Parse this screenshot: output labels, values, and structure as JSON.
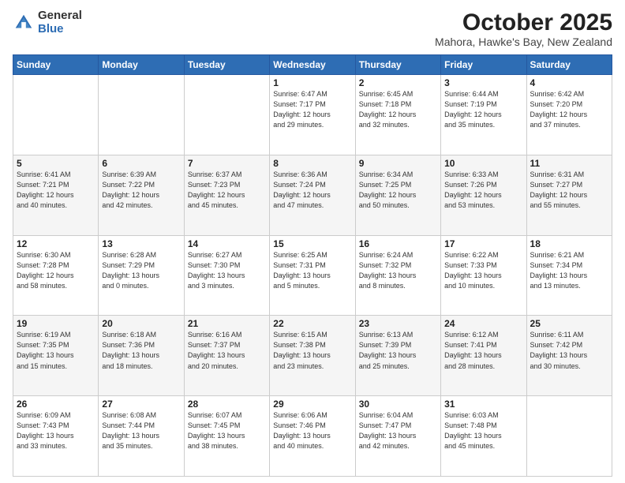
{
  "header": {
    "logo": {
      "general": "General",
      "blue": "Blue"
    },
    "title": "October 2025",
    "subtitle": "Mahora, Hawke's Bay, New Zealand"
  },
  "days_of_week": [
    "Sunday",
    "Monday",
    "Tuesday",
    "Wednesday",
    "Thursday",
    "Friday",
    "Saturday"
  ],
  "weeks": [
    [
      {
        "day": "",
        "info": ""
      },
      {
        "day": "",
        "info": ""
      },
      {
        "day": "",
        "info": ""
      },
      {
        "day": "1",
        "info": "Sunrise: 6:47 AM\nSunset: 7:17 PM\nDaylight: 12 hours\nand 29 minutes."
      },
      {
        "day": "2",
        "info": "Sunrise: 6:45 AM\nSunset: 7:18 PM\nDaylight: 12 hours\nand 32 minutes."
      },
      {
        "day": "3",
        "info": "Sunrise: 6:44 AM\nSunset: 7:19 PM\nDaylight: 12 hours\nand 35 minutes."
      },
      {
        "day": "4",
        "info": "Sunrise: 6:42 AM\nSunset: 7:20 PM\nDaylight: 12 hours\nand 37 minutes."
      }
    ],
    [
      {
        "day": "5",
        "info": "Sunrise: 6:41 AM\nSunset: 7:21 PM\nDaylight: 12 hours\nand 40 minutes."
      },
      {
        "day": "6",
        "info": "Sunrise: 6:39 AM\nSunset: 7:22 PM\nDaylight: 12 hours\nand 42 minutes."
      },
      {
        "day": "7",
        "info": "Sunrise: 6:37 AM\nSunset: 7:23 PM\nDaylight: 12 hours\nand 45 minutes."
      },
      {
        "day": "8",
        "info": "Sunrise: 6:36 AM\nSunset: 7:24 PM\nDaylight: 12 hours\nand 47 minutes."
      },
      {
        "day": "9",
        "info": "Sunrise: 6:34 AM\nSunset: 7:25 PM\nDaylight: 12 hours\nand 50 minutes."
      },
      {
        "day": "10",
        "info": "Sunrise: 6:33 AM\nSunset: 7:26 PM\nDaylight: 12 hours\nand 53 minutes."
      },
      {
        "day": "11",
        "info": "Sunrise: 6:31 AM\nSunset: 7:27 PM\nDaylight: 12 hours\nand 55 minutes."
      }
    ],
    [
      {
        "day": "12",
        "info": "Sunrise: 6:30 AM\nSunset: 7:28 PM\nDaylight: 12 hours\nand 58 minutes."
      },
      {
        "day": "13",
        "info": "Sunrise: 6:28 AM\nSunset: 7:29 PM\nDaylight: 13 hours\nand 0 minutes."
      },
      {
        "day": "14",
        "info": "Sunrise: 6:27 AM\nSunset: 7:30 PM\nDaylight: 13 hours\nand 3 minutes."
      },
      {
        "day": "15",
        "info": "Sunrise: 6:25 AM\nSunset: 7:31 PM\nDaylight: 13 hours\nand 5 minutes."
      },
      {
        "day": "16",
        "info": "Sunrise: 6:24 AM\nSunset: 7:32 PM\nDaylight: 13 hours\nand 8 minutes."
      },
      {
        "day": "17",
        "info": "Sunrise: 6:22 AM\nSunset: 7:33 PM\nDaylight: 13 hours\nand 10 minutes."
      },
      {
        "day": "18",
        "info": "Sunrise: 6:21 AM\nSunset: 7:34 PM\nDaylight: 13 hours\nand 13 minutes."
      }
    ],
    [
      {
        "day": "19",
        "info": "Sunrise: 6:19 AM\nSunset: 7:35 PM\nDaylight: 13 hours\nand 15 minutes."
      },
      {
        "day": "20",
        "info": "Sunrise: 6:18 AM\nSunset: 7:36 PM\nDaylight: 13 hours\nand 18 minutes."
      },
      {
        "day": "21",
        "info": "Sunrise: 6:16 AM\nSunset: 7:37 PM\nDaylight: 13 hours\nand 20 minutes."
      },
      {
        "day": "22",
        "info": "Sunrise: 6:15 AM\nSunset: 7:38 PM\nDaylight: 13 hours\nand 23 minutes."
      },
      {
        "day": "23",
        "info": "Sunrise: 6:13 AM\nSunset: 7:39 PM\nDaylight: 13 hours\nand 25 minutes."
      },
      {
        "day": "24",
        "info": "Sunrise: 6:12 AM\nSunset: 7:41 PM\nDaylight: 13 hours\nand 28 minutes."
      },
      {
        "day": "25",
        "info": "Sunrise: 6:11 AM\nSunset: 7:42 PM\nDaylight: 13 hours\nand 30 minutes."
      }
    ],
    [
      {
        "day": "26",
        "info": "Sunrise: 6:09 AM\nSunset: 7:43 PM\nDaylight: 13 hours\nand 33 minutes."
      },
      {
        "day": "27",
        "info": "Sunrise: 6:08 AM\nSunset: 7:44 PM\nDaylight: 13 hours\nand 35 minutes."
      },
      {
        "day": "28",
        "info": "Sunrise: 6:07 AM\nSunset: 7:45 PM\nDaylight: 13 hours\nand 38 minutes."
      },
      {
        "day": "29",
        "info": "Sunrise: 6:06 AM\nSunset: 7:46 PM\nDaylight: 13 hours\nand 40 minutes."
      },
      {
        "day": "30",
        "info": "Sunrise: 6:04 AM\nSunset: 7:47 PM\nDaylight: 13 hours\nand 42 minutes."
      },
      {
        "day": "31",
        "info": "Sunrise: 6:03 AM\nSunset: 7:48 PM\nDaylight: 13 hours\nand 45 minutes."
      },
      {
        "day": "",
        "info": ""
      }
    ]
  ]
}
